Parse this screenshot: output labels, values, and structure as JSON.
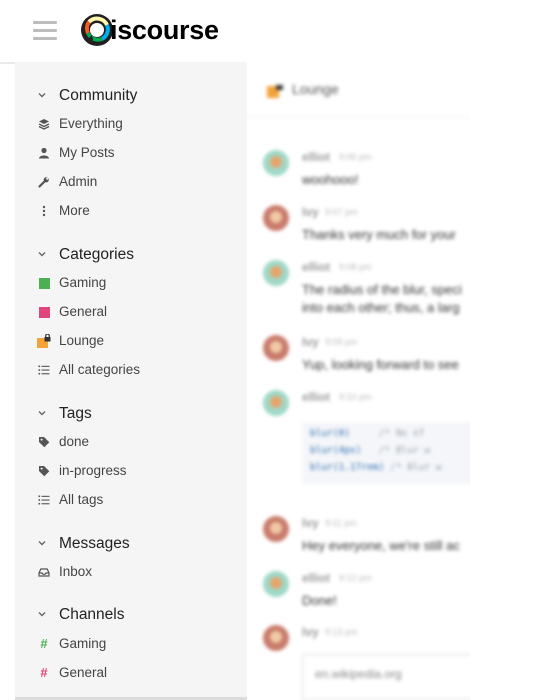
{
  "app": {
    "logo_text": "iscourse",
    "logo_letter": "D"
  },
  "sidebar": {
    "community": {
      "title": "Community",
      "items": [
        {
          "label": "Everything",
          "icon": "layers-icon"
        },
        {
          "label": "My Posts",
          "icon": "user-icon"
        },
        {
          "label": "Admin",
          "icon": "wrench-icon"
        },
        {
          "label": "More",
          "icon": "vertical-ellipsis-icon"
        }
      ]
    },
    "categories": {
      "title": "Categories",
      "items": [
        {
          "label": "Gaming",
          "color": "#4caf50"
        },
        {
          "label": "General",
          "color": "#e0447c"
        },
        {
          "label": "Lounge",
          "color": "#f2a33a",
          "locked": true
        },
        {
          "label": "All categories",
          "icon": "list-icon"
        }
      ]
    },
    "tags": {
      "title": "Tags",
      "items": [
        {
          "label": "done",
          "icon": "tag-icon"
        },
        {
          "label": "in-progress",
          "icon": "tag-icon"
        },
        {
          "label": "All tags",
          "icon": "list-icon"
        }
      ]
    },
    "messages": {
      "title": "Messages",
      "items": [
        {
          "label": "Inbox",
          "icon": "inbox-icon"
        }
      ]
    },
    "channels": {
      "title": "Channels",
      "items": [
        {
          "label": "Gaming",
          "color": "#4caf50"
        },
        {
          "label": "General",
          "color": "#e0447c"
        }
      ]
    }
  },
  "chat": {
    "channel_name": "Lounge",
    "messages": [
      {
        "user": "elliot",
        "time": "9:06 pm",
        "text": "woohooo!"
      },
      {
        "user": "Ivy",
        "time": "9:07 pm",
        "text": "Thanks very much for your"
      },
      {
        "user": "elliot",
        "time": "9:08 pm",
        "text": "The radius of the blur, speci",
        "text2": "into each other; thus, a larg"
      },
      {
        "user": "Ivy",
        "time": "9:09 pm",
        "text": "Yup, looking forward to see"
      },
      {
        "user": "elliot",
        "time": "9:10 pm",
        "code": [
          "blur(0)",
          "blur(4px)",
          "blur(1.17rem)"
        ],
        "code_comments": [
          "/* No ef",
          "/* Blur w",
          "/* Blur w"
        ]
      },
      {
        "user": "Ivy",
        "time": "9:11 pm",
        "text": "Hey everyone, we're still ac"
      },
      {
        "user": "elliot",
        "time": "9:12 pm",
        "text": "Done!"
      },
      {
        "user": "Ivy",
        "time": "9:13 pm",
        "link": "en.wikipedia.org"
      }
    ]
  }
}
